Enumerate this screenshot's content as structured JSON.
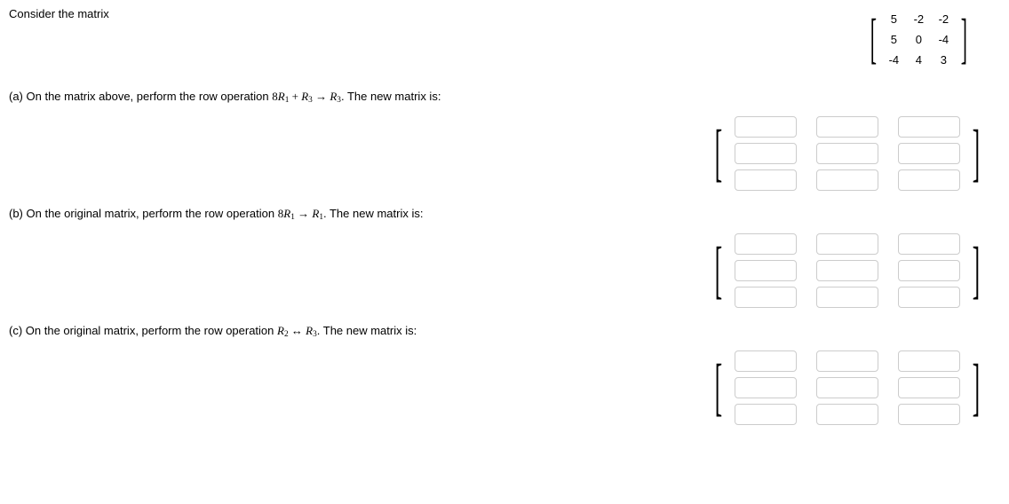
{
  "intro": "Consider the matrix",
  "matrix": {
    "r0c0": "5",
    "r0c1": "-2",
    "r0c2": "-2",
    "r1c0": "5",
    "r1c1": "0",
    "r1c2": "-4",
    "r2c0": "-4",
    "r2c1": "4",
    "r2c2": "3"
  },
  "parts": {
    "a": {
      "prefix": "(a) On the matrix above, perform the row operation ",
      "op_coeff": "8",
      "op_r_a": "R",
      "op_sub_a": "1",
      "op_plus": " + ",
      "op_r_b": "R",
      "op_sub_b": "3",
      "op_arrow": " → ",
      "op_r_c": "R",
      "op_sub_c": "3",
      "suffix": ". The new matrix is:"
    },
    "b": {
      "prefix": "(b) On the original matrix, perform the row operation ",
      "op_coeff": "8",
      "op_r_a": "R",
      "op_sub_a": "1",
      "op_arrow": " → ",
      "op_r_c": "R",
      "op_sub_c": "1",
      "suffix": ". The new matrix is:"
    },
    "c": {
      "prefix": "(c) On the original matrix, perform the row operation ",
      "op_r_a": "R",
      "op_sub_a": "2",
      "op_swap": " ↔ ",
      "op_r_c": "R",
      "op_sub_c": "3",
      "suffix": ". The new matrix is:"
    }
  },
  "brackets": {
    "left": "[",
    "right": "]"
  }
}
